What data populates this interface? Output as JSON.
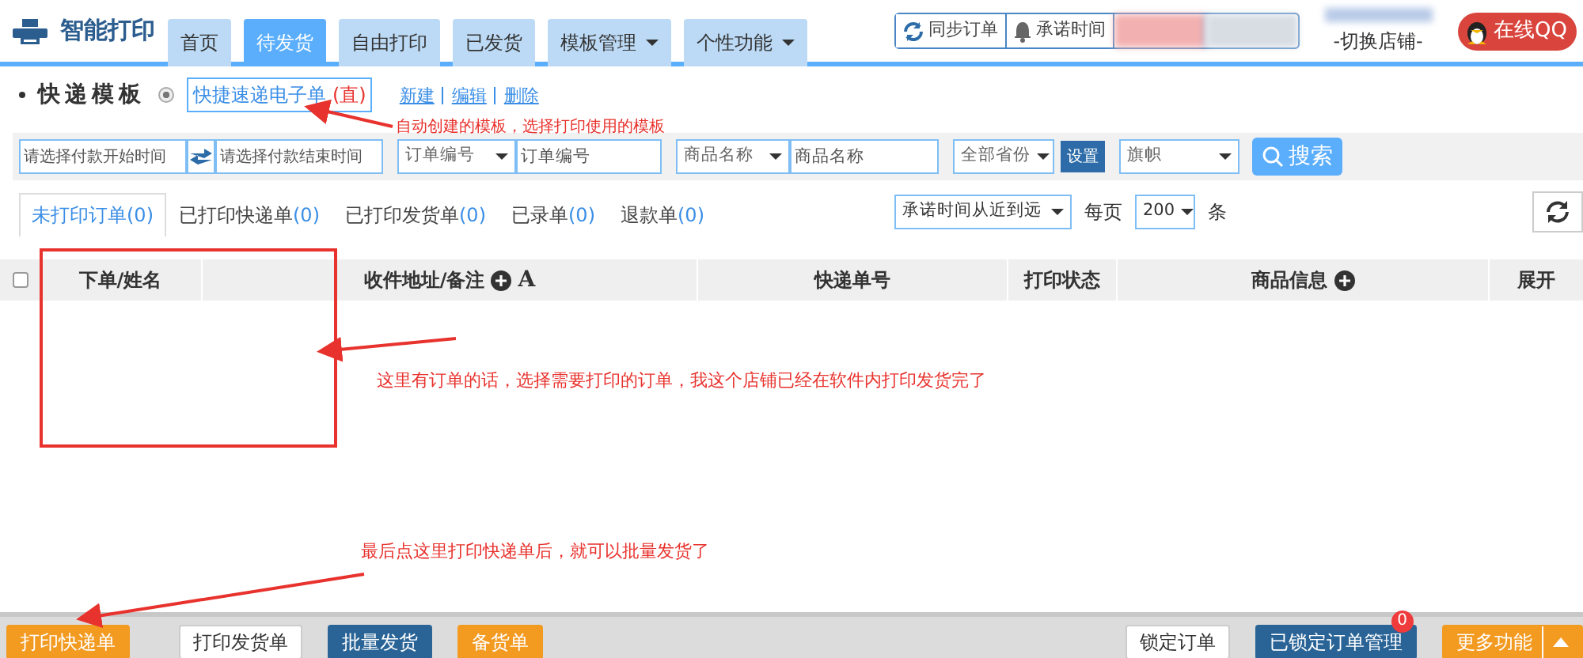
{
  "brand": {
    "name": "智能打印"
  },
  "nav_tabs": [
    {
      "label": "首页",
      "selected": false,
      "dropdown": false
    },
    {
      "label": "待发货",
      "selected": true,
      "dropdown": false
    },
    {
      "label": "自由打印",
      "selected": false,
      "dropdown": false
    },
    {
      "label": "已发货",
      "selected": false,
      "dropdown": false
    },
    {
      "label": "模板管理",
      "selected": false,
      "dropdown": true
    },
    {
      "label": "个性功能",
      "selected": false,
      "dropdown": true
    }
  ],
  "toolbar_buttons": [
    {
      "label": "同步订单",
      "kind": "sync"
    },
    {
      "label": "承诺时间",
      "kind": "bell"
    }
  ],
  "store_switch": "-切换店铺-",
  "qq_button": "在线QQ",
  "template": {
    "title": "快递模板",
    "option": {
      "label": "快捷速递电子单",
      "tag": "(直)",
      "selected": true
    },
    "actions": [
      "新建",
      "编辑",
      "删除"
    ]
  },
  "filters": {
    "start_date": {
      "placeholder": "请选择付款开始时间"
    },
    "end_date": {
      "placeholder": "请选择付款结束时间"
    },
    "order_field": {
      "value": "订单编号"
    },
    "order_input": {
      "placeholder": "订单编号"
    },
    "goods_field": {
      "value": "商品名称"
    },
    "goods_input": {
      "placeholder": "商品名称"
    },
    "province": {
      "value": "全部省份"
    },
    "settings_button": "设置",
    "flag": {
      "value": "旗帜"
    },
    "search_button": "搜索"
  },
  "order_tabs": [
    {
      "label": "未打印订单",
      "count": "(0)",
      "selected": true
    },
    {
      "label": "已打印快递单",
      "count": "(0)",
      "selected": false
    },
    {
      "label": "已打印发货单",
      "count": "(0)",
      "selected": false
    },
    {
      "label": "已录单",
      "count": "(0)",
      "selected": false
    },
    {
      "label": "退款单",
      "count": "(0)",
      "selected": false
    }
  ],
  "sort": {
    "value": "承诺时间从近到远"
  },
  "per_page_label": "每页",
  "page_size": {
    "value": "200"
  },
  "per_page_unit": "条",
  "table": {
    "columns": [
      {
        "kind": "checkbox",
        "checked": false
      },
      {
        "kind": "text",
        "label": "下单/姓名"
      },
      {
        "kind": "address",
        "label": "收件地址/备注",
        "extra": "A"
      },
      {
        "kind": "text",
        "label": "快递单号"
      },
      {
        "kind": "text",
        "label": "打印状态"
      },
      {
        "kind": "plus",
        "label": "商品信息"
      },
      {
        "kind": "text",
        "label": "展开"
      }
    ]
  },
  "bottom_bar": {
    "left": [
      {
        "label": "打印快递单",
        "kind": "orange"
      },
      {
        "label": "打印发货单",
        "kind": "white"
      },
      {
        "label": "批量发货",
        "kind": "navy"
      },
      {
        "label": "备货单",
        "kind": "orange"
      }
    ],
    "right": [
      {
        "label": "锁定订单",
        "kind": "white"
      },
      {
        "label": "已锁定订单管理",
        "kind": "navy",
        "badge": "0"
      },
      {
        "label": "更多功能",
        "kind": "orange-split"
      }
    ]
  },
  "annotations": {
    "notes": [
      "自动创建的模板，选择打印使用的模板",
      "这里有订单的话，选择需要打印的订单，我这个店铺已经在软件内打印发货完了",
      "最后点这里打印快递单后，就可以批量发货了"
    ]
  }
}
